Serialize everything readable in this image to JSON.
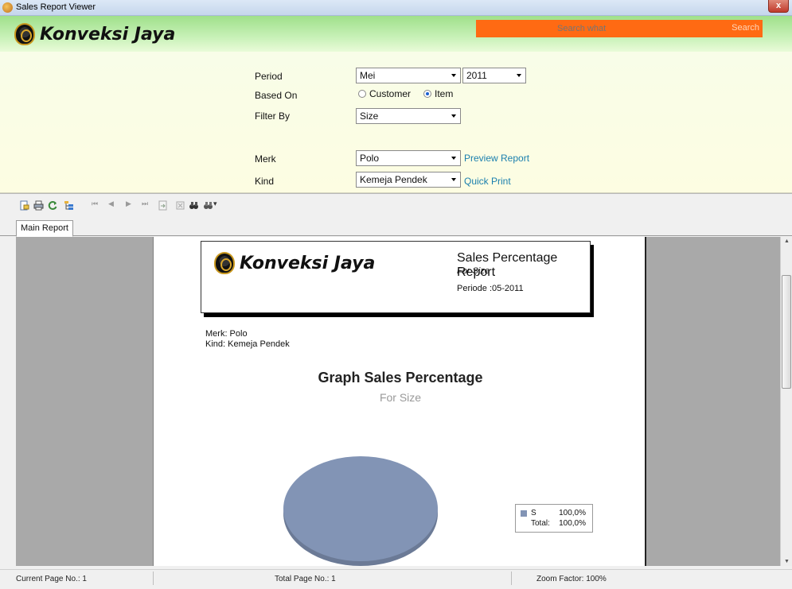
{
  "window": {
    "title": "Sales Report Viewer",
    "close_label": "x"
  },
  "header": {
    "brand": "Konveksi Jaya",
    "search_placeholder": "Search what",
    "search_button": "Search"
  },
  "form": {
    "period_label": "Period",
    "period_month": "Mei",
    "period_year": "2011",
    "based_on_label": "Based On",
    "based_on_options": [
      "Customer",
      "Item"
    ],
    "based_on_selected": "Item",
    "filter_by_label": "Filter By",
    "filter_by_value": "Size",
    "merk_label": "Merk",
    "merk_value": "Polo",
    "kind_label": "Kind",
    "kind_value": "Kemeja Pendek",
    "preview_link": "Preview Report",
    "print_link": "Quick Print"
  },
  "viewer": {
    "tab_label": "Main Report"
  },
  "report": {
    "brand": "Konveksi Jaya",
    "title": "Sales Percentage Report",
    "for_line": "For Size",
    "period_line": "Periode :05-2011",
    "merk_line": "Merk: Polo",
    "kind_line": "Kind: Kemeja Pendek",
    "graph_title": "Graph Sales Percentage",
    "graph_subtitle": "For Size",
    "legend_item_label": "S",
    "legend_item_value": "100,0%",
    "legend_total_label": "Total:",
    "legend_total_value": "100,0%",
    "pie_color": "#8294b5"
  },
  "status": {
    "current_page": "Current Page No.: 1",
    "total_page": "Total Page No.: 1",
    "zoom": "Zoom Factor: 100%"
  }
}
